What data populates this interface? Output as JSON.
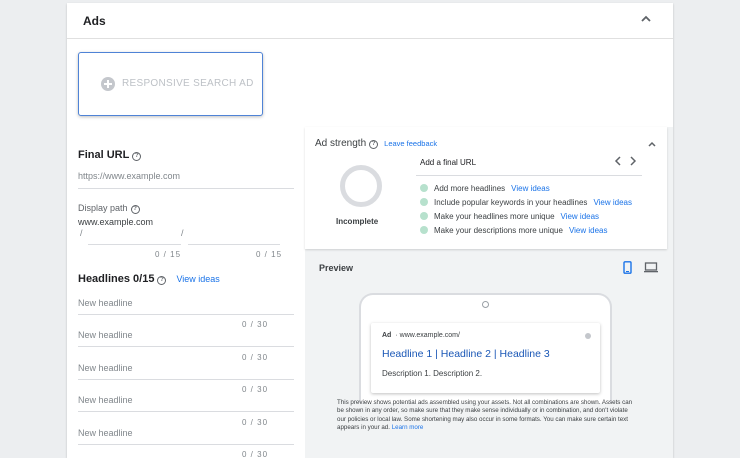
{
  "header": {
    "title": "Ads"
  },
  "rsa_button": {
    "label": "RESPONSIVE SEARCH AD"
  },
  "final_url": {
    "label": "Final URL",
    "placeholder": "https://www.example.com"
  },
  "display_path": {
    "label": "Display path",
    "domain": "www.example.com",
    "separator": "/",
    "path1_count": "0 / 15",
    "path2_count": "0 / 15"
  },
  "headlines": {
    "title": "Headlines 0/15",
    "view_ideas": "View ideas",
    "items": [
      {
        "placeholder": "New headline",
        "count": "0 / 30"
      },
      {
        "placeholder": "New headline",
        "count": "0 / 30"
      },
      {
        "placeholder": "New headline",
        "count": "0 / 30"
      },
      {
        "placeholder": "New headline",
        "count": "0 / 30"
      },
      {
        "placeholder": "New headline",
        "count": "0 / 30"
      }
    ]
  },
  "ad_strength": {
    "title": "Ad strength",
    "feedback": "Leave feedback",
    "status": "Incomplete",
    "final_url_prompt": "Add a final URL",
    "tips": [
      {
        "text": "Add more headlines",
        "link": "View ideas"
      },
      {
        "text": "Include popular keywords in your headlines",
        "link": "View ideas"
      },
      {
        "text": "Make your headlines more unique",
        "link": "View ideas"
      },
      {
        "text": "Make your descriptions more unique",
        "link": "View ideas"
      }
    ]
  },
  "preview": {
    "title": "Preview",
    "ad_label": "Ad",
    "ad_separator": "·",
    "ad_url": "www.example.com/",
    "headline": "Headline 1 | Headline 2 | Headline 3",
    "description": "Description 1. Description 2.",
    "disclaimer": "This preview shows potential ads assembled using your assets. Not all combinations are shown. Assets can be shown in any order, so make sure that they make sense individually or in combination, and don't violate our policies or local law. Some shortening may also occur in some formats. You can make sure certain text appears in your ad.",
    "learn_more": "Learn more"
  },
  "colors": {
    "accent": "#1a73e8",
    "tip_dot": "#b7e1cd",
    "button_border": "#4f83d6"
  },
  "icons": [
    "chevron-up-icon",
    "add-circle-icon",
    "help-icon",
    "chevron-left-icon",
    "chevron-right-icon",
    "mobile-icon",
    "desktop-icon",
    "info-icon"
  ]
}
